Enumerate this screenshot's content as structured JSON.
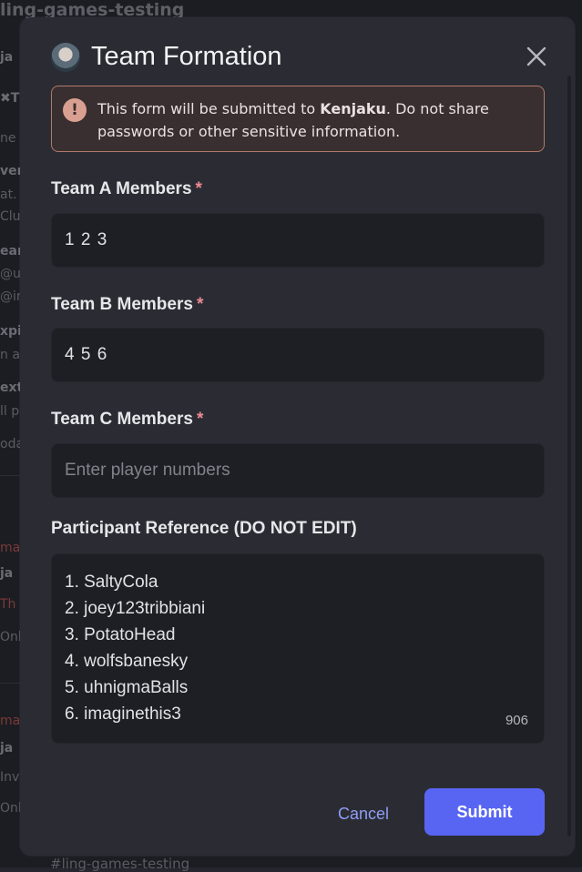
{
  "background": {
    "channel_title": "ling-games-testing",
    "fragments": [
      "ja",
      "✖T",
      "ne",
      "ver",
      "at.",
      "Clus",
      "ear",
      "@uh",
      "@im",
      "xpi",
      "n a",
      "ext",
      "ll p",
      "oda",
      "ma",
      "ja",
      "Th",
      "Only",
      "ma",
      "ja",
      "Inv",
      "Only"
    ],
    "bottom_text": "#ling-games-testing"
  },
  "modal": {
    "title": "Team Formation",
    "close_label": "×"
  },
  "notice": {
    "icon": "!",
    "text_before": "This form will be submitted to ",
    "recipient": "Kenjaku",
    "text_after": ". Do not share passwords or other sensitive information."
  },
  "fields": {
    "team_a": {
      "label": "Team A Members",
      "required_mark": "*",
      "value": "1 2 3"
    },
    "team_b": {
      "label": "Team B Members",
      "required_mark": "*",
      "value": "4 5 6"
    },
    "team_c": {
      "label": "Team C Members",
      "required_mark": "*",
      "placeholder": "Enter player numbers"
    },
    "reference": {
      "label": "Participant Reference (DO NOT EDIT)",
      "lines": [
        "1. SaltyCola",
        "2. joey123tribbiani",
        "3. PotatoHead",
        "4. wolfsbanesky",
        "5. uhnigmaBalls",
        "6. imaginethis3"
      ],
      "counter": "906"
    }
  },
  "buttons": {
    "cancel": "Cancel",
    "submit": "Submit"
  },
  "colors": {
    "accent": "#5865f2",
    "link": "#8e9cf5",
    "required": "#ed8a94",
    "warning_border": "#b07a6a"
  }
}
